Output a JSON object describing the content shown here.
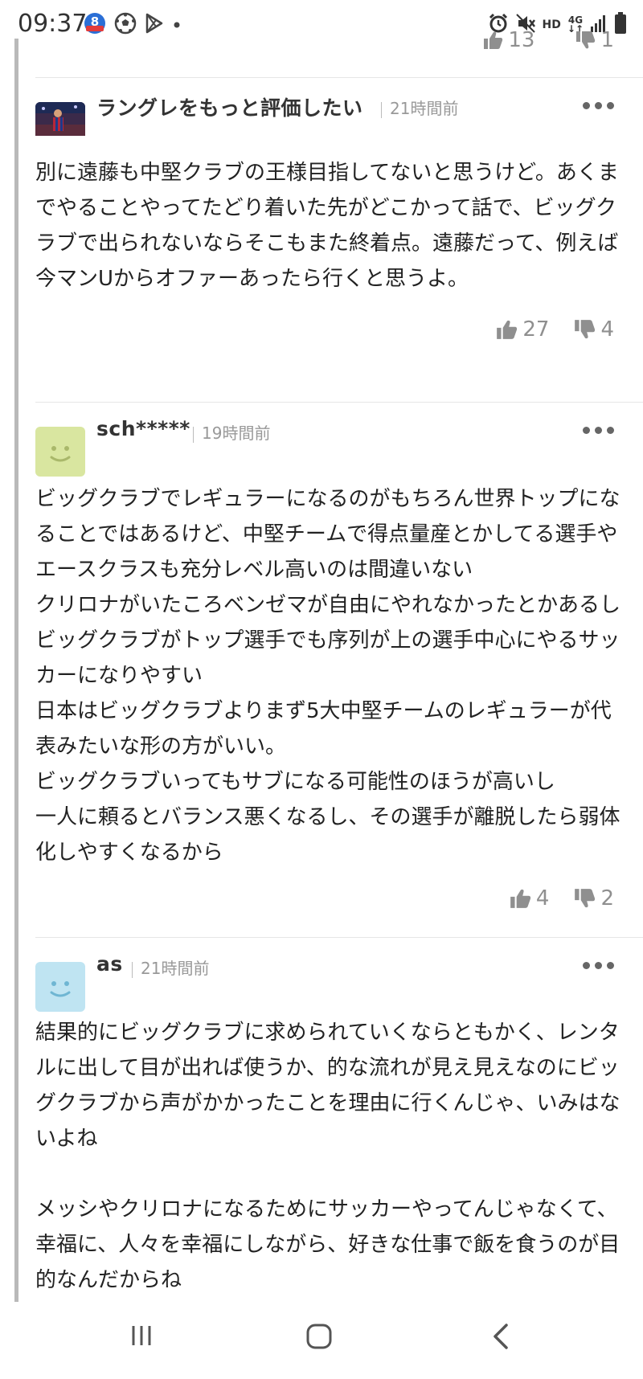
{
  "status_bar": {
    "time": "09:37",
    "notification_icons": [
      "app-8-icon",
      "soccer-ball-icon",
      "play-store-icon",
      "dot-icon"
    ],
    "system_icons": [
      "alarm-icon",
      "mute-icon",
      "hd-icon",
      "4g-icon",
      "signal-icon",
      "battery-icon"
    ],
    "hd_label": "HD",
    "network_label": "4G"
  },
  "previous_comment": {
    "likes": "13",
    "dislikes": "1"
  },
  "comments": [
    {
      "username": "ラングレをもっと評価したい",
      "time": "21時間前",
      "body": "別に遠藤も中堅クラブの王様目指してないと思うけど。あくまでやることやってたどり着いた先がどこかって話で、ビッグクラブで出られないならそこもまた終着点。遠藤だって、例えば今マンUからオファーあったら行くと思うよ。",
      "likes": "27",
      "dislikes": "4",
      "avatar": "photo"
    },
    {
      "username": "sch*****",
      "time": "19時間前",
      "body": "ビッグクラブでレギュラーになるのがもちろん世界トップになることではあるけど、中堅チームで得点量産とかしてる選手やエースクラスも充分レベル高いのは間違いない\nクリロナがいたころベンゼマが自由にやれなかったとかあるしビッグクラブがトップ選手でも序列が上の選手中心にやるサッカーになりやすい\n日本はビッグクラブよりまず5大中堅チームのレギュラーが代表みたいな形の方がいい。\nビッグクラブいってもサブになる可能性のほうが高いし\n一人に頼るとバランス悪くなるし、その選手が離脱したら弱体化しやすくなるから",
      "likes": "4",
      "dislikes": "2",
      "avatar": "smiley",
      "avatar_color": "#d9e6a0",
      "avatar_face_color": "#a9b86a"
    },
    {
      "username": "as",
      "time": "21時間前",
      "body": "結果的にビッグクラブに求められていくならともかく、レンタルに出して目が出れば使うか、的な流れが見え見えなのにビッグクラブから声がかかったことを理由に行くんじゃ、いみはないよね\n\nメッシやクリロナになるためにサッカーやってんじゃなくて、幸福に、人々を幸福にしながら、好きな仕事で飯を食うのが目的なんだからね",
      "avatar": "smiley",
      "avatar_color": "#bfe4f2",
      "avatar_face_color": "#6fb6d3"
    }
  ],
  "nav_bar": {
    "buttons": [
      "recent-apps-icon",
      "home-icon",
      "back-icon"
    ]
  },
  "colors": {
    "text": "#222222",
    "muted": "#999999",
    "icon": "#8f8f8f",
    "divider": "#e6e6e6"
  }
}
